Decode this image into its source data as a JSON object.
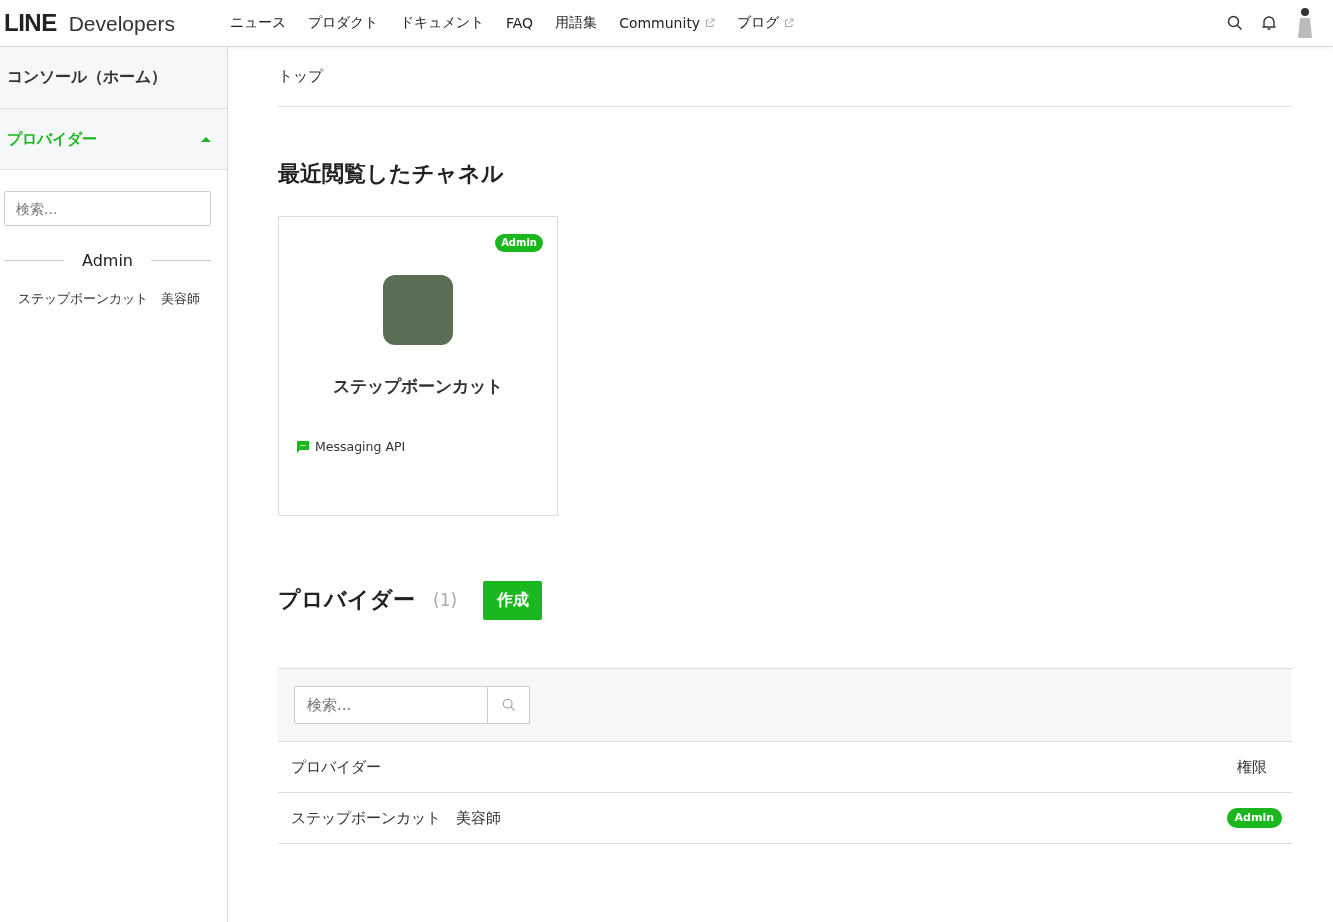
{
  "header": {
    "logo": {
      "brand": "LINE",
      "product": "Developers"
    },
    "nav": [
      {
        "label": "ニュース",
        "external": false
      },
      {
        "label": "プロダクト",
        "external": false
      },
      {
        "label": "ドキュメント",
        "external": false
      },
      {
        "label": "FAQ",
        "external": false
      },
      {
        "label": "用語集",
        "external": false
      },
      {
        "label": "Community",
        "external": true
      },
      {
        "label": "ブログ",
        "external": true
      }
    ]
  },
  "sidebar": {
    "home": "コンソール（ホーム）",
    "section": {
      "label": "プロバイダー",
      "expanded": true
    },
    "search": {
      "placeholder": "検索..."
    },
    "group": "Admin",
    "items": [
      "ステップボーンカット　美容師"
    ]
  },
  "breadcrumb": "トップ",
  "recent": {
    "title": "最近閲覧したチャネル",
    "channels": [
      {
        "badge": "Admin",
        "name": "ステップボーンカット",
        "type": "Messaging API"
      }
    ]
  },
  "providers": {
    "title": "プロバイダー",
    "count": "(1)",
    "create_button": "作成",
    "search": {
      "placeholder": "検索..."
    },
    "table": {
      "columns": [
        "プロバイダー",
        "権限"
      ],
      "rows": [
        {
          "name": "ステップボーンカット　美容師",
          "role": "Admin"
        }
      ]
    }
  }
}
